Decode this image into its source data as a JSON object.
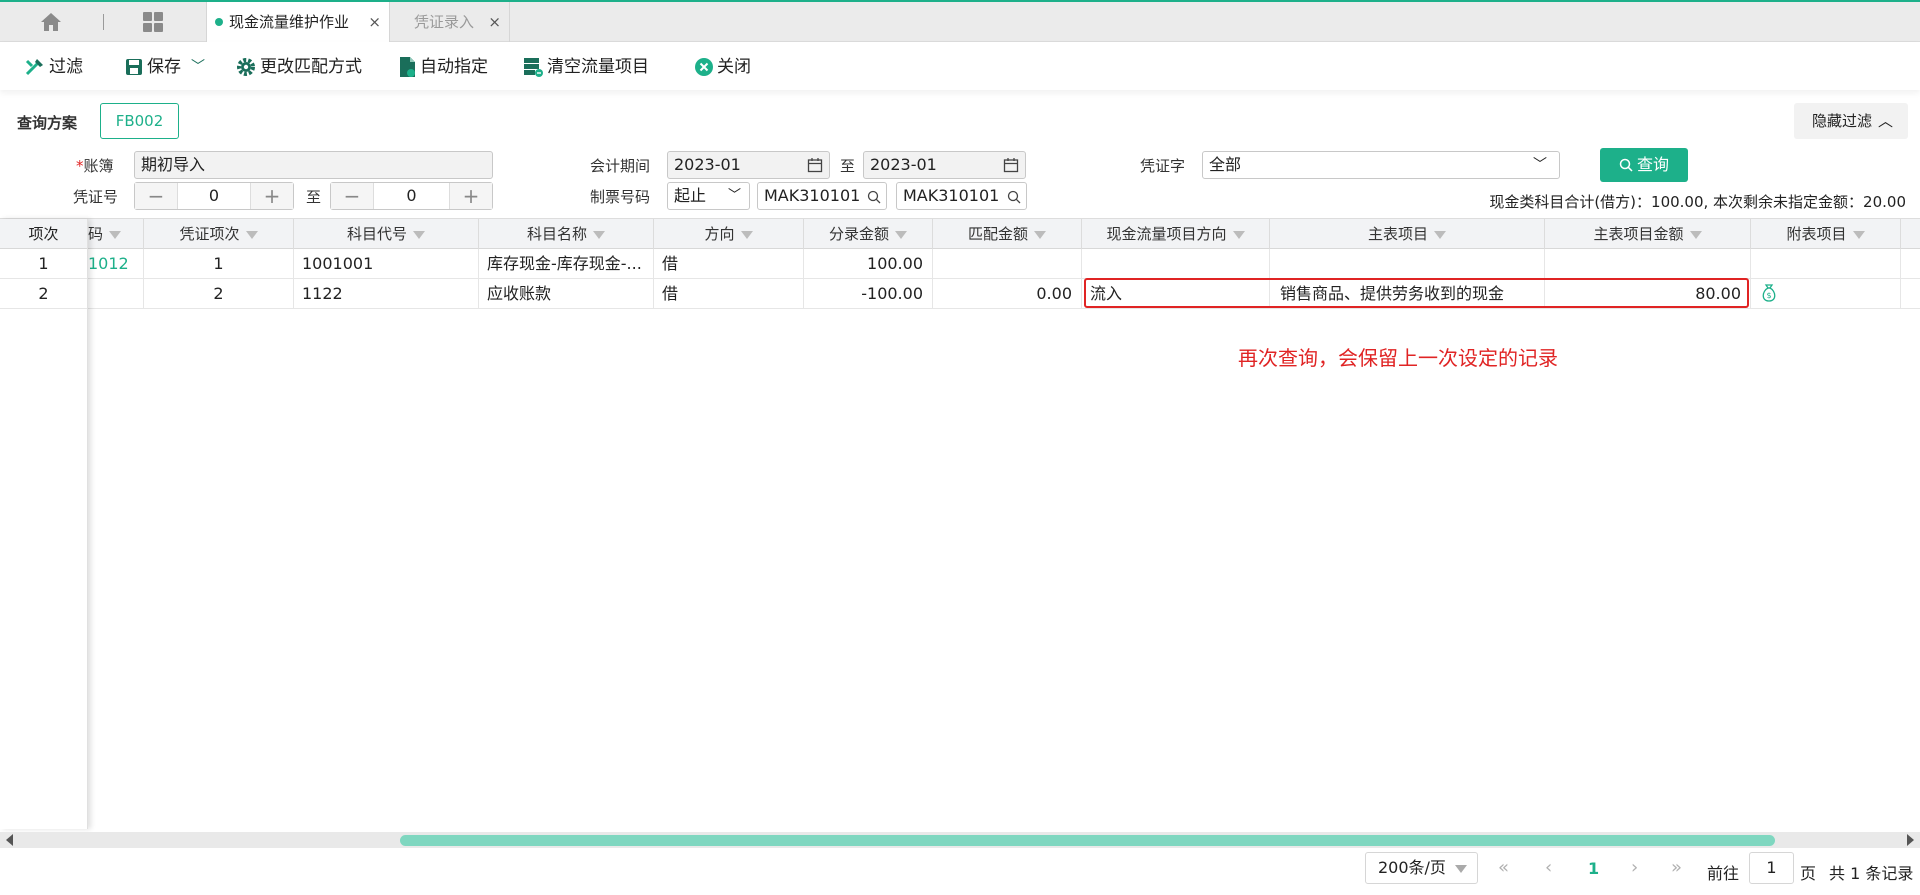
{
  "tabs": [
    {
      "label": "现金流量维护作业",
      "active": true
    },
    {
      "label": "凭证录入",
      "active": false
    }
  ],
  "toolbar": {
    "filter": "过滤",
    "save": "保存",
    "change_match": "更改匹配方式",
    "auto_assign": "自动指定",
    "clear_items": "清空流量项目",
    "close": "关闭"
  },
  "query": {
    "scheme_label": "查询方案",
    "scheme_value": "FB002",
    "hide_filter": "隐藏过滤",
    "ledger_label": "账簿",
    "ledger_required": "*",
    "ledger_value": "期初导入",
    "voucher_no_label": "凭证号",
    "voucher_no_from": "0",
    "voucher_no_to": "0",
    "to_label": "至",
    "period_label": "会计期间",
    "period_from": "2023-01",
    "period_to": "2023-01",
    "maker_label": "制票号码",
    "maker_mode": "起止",
    "maker_from": "MAK310101",
    "maker_to": "MAK310101",
    "voucher_word_label": "凭证字",
    "voucher_word_value": "全部",
    "search_button": "查询",
    "summary": "现金类科目合计(借方)：100.00, 本次剩余未指定金额：20.00"
  },
  "table": {
    "columns": [
      "项次",
      "码",
      "凭证项次",
      "科目代号",
      "科目名称",
      "方向",
      "分录金额",
      "匹配金额",
      "现金流量项目方向",
      "主表项目",
      "主表项目金额",
      "附表项目"
    ],
    "rows": [
      {
        "idx": "1",
        "code": "1012",
        "item": "1",
        "acct_code": "1001001",
        "acct_name": "库存现金-库存现金-...",
        "dir": "借",
        "amount": "100.00",
        "match": "",
        "cf_dir": "",
        "main_item": "",
        "main_amount": "",
        "sub_item": ""
      },
      {
        "idx": "2",
        "code": "",
        "item": "2",
        "acct_code": "1122",
        "acct_name": "应收账款",
        "dir": "借",
        "amount": "-100.00",
        "match": "0.00",
        "cf_dir": "流入",
        "main_item": "销售商品、提供劳务收到的现金",
        "main_amount": "80.00",
        "sub_item": "money-bag-icon"
      }
    ]
  },
  "annotation": "再次查询，会保留上一次设定的记录",
  "pager": {
    "page_size": "200条/页",
    "current": "1",
    "goto_label": "前往",
    "goto_value": "1",
    "page_unit": "页",
    "total": "共 1 条记录"
  },
  "colors": {
    "accent": "#1db08a",
    "highlight": "#e02424"
  }
}
